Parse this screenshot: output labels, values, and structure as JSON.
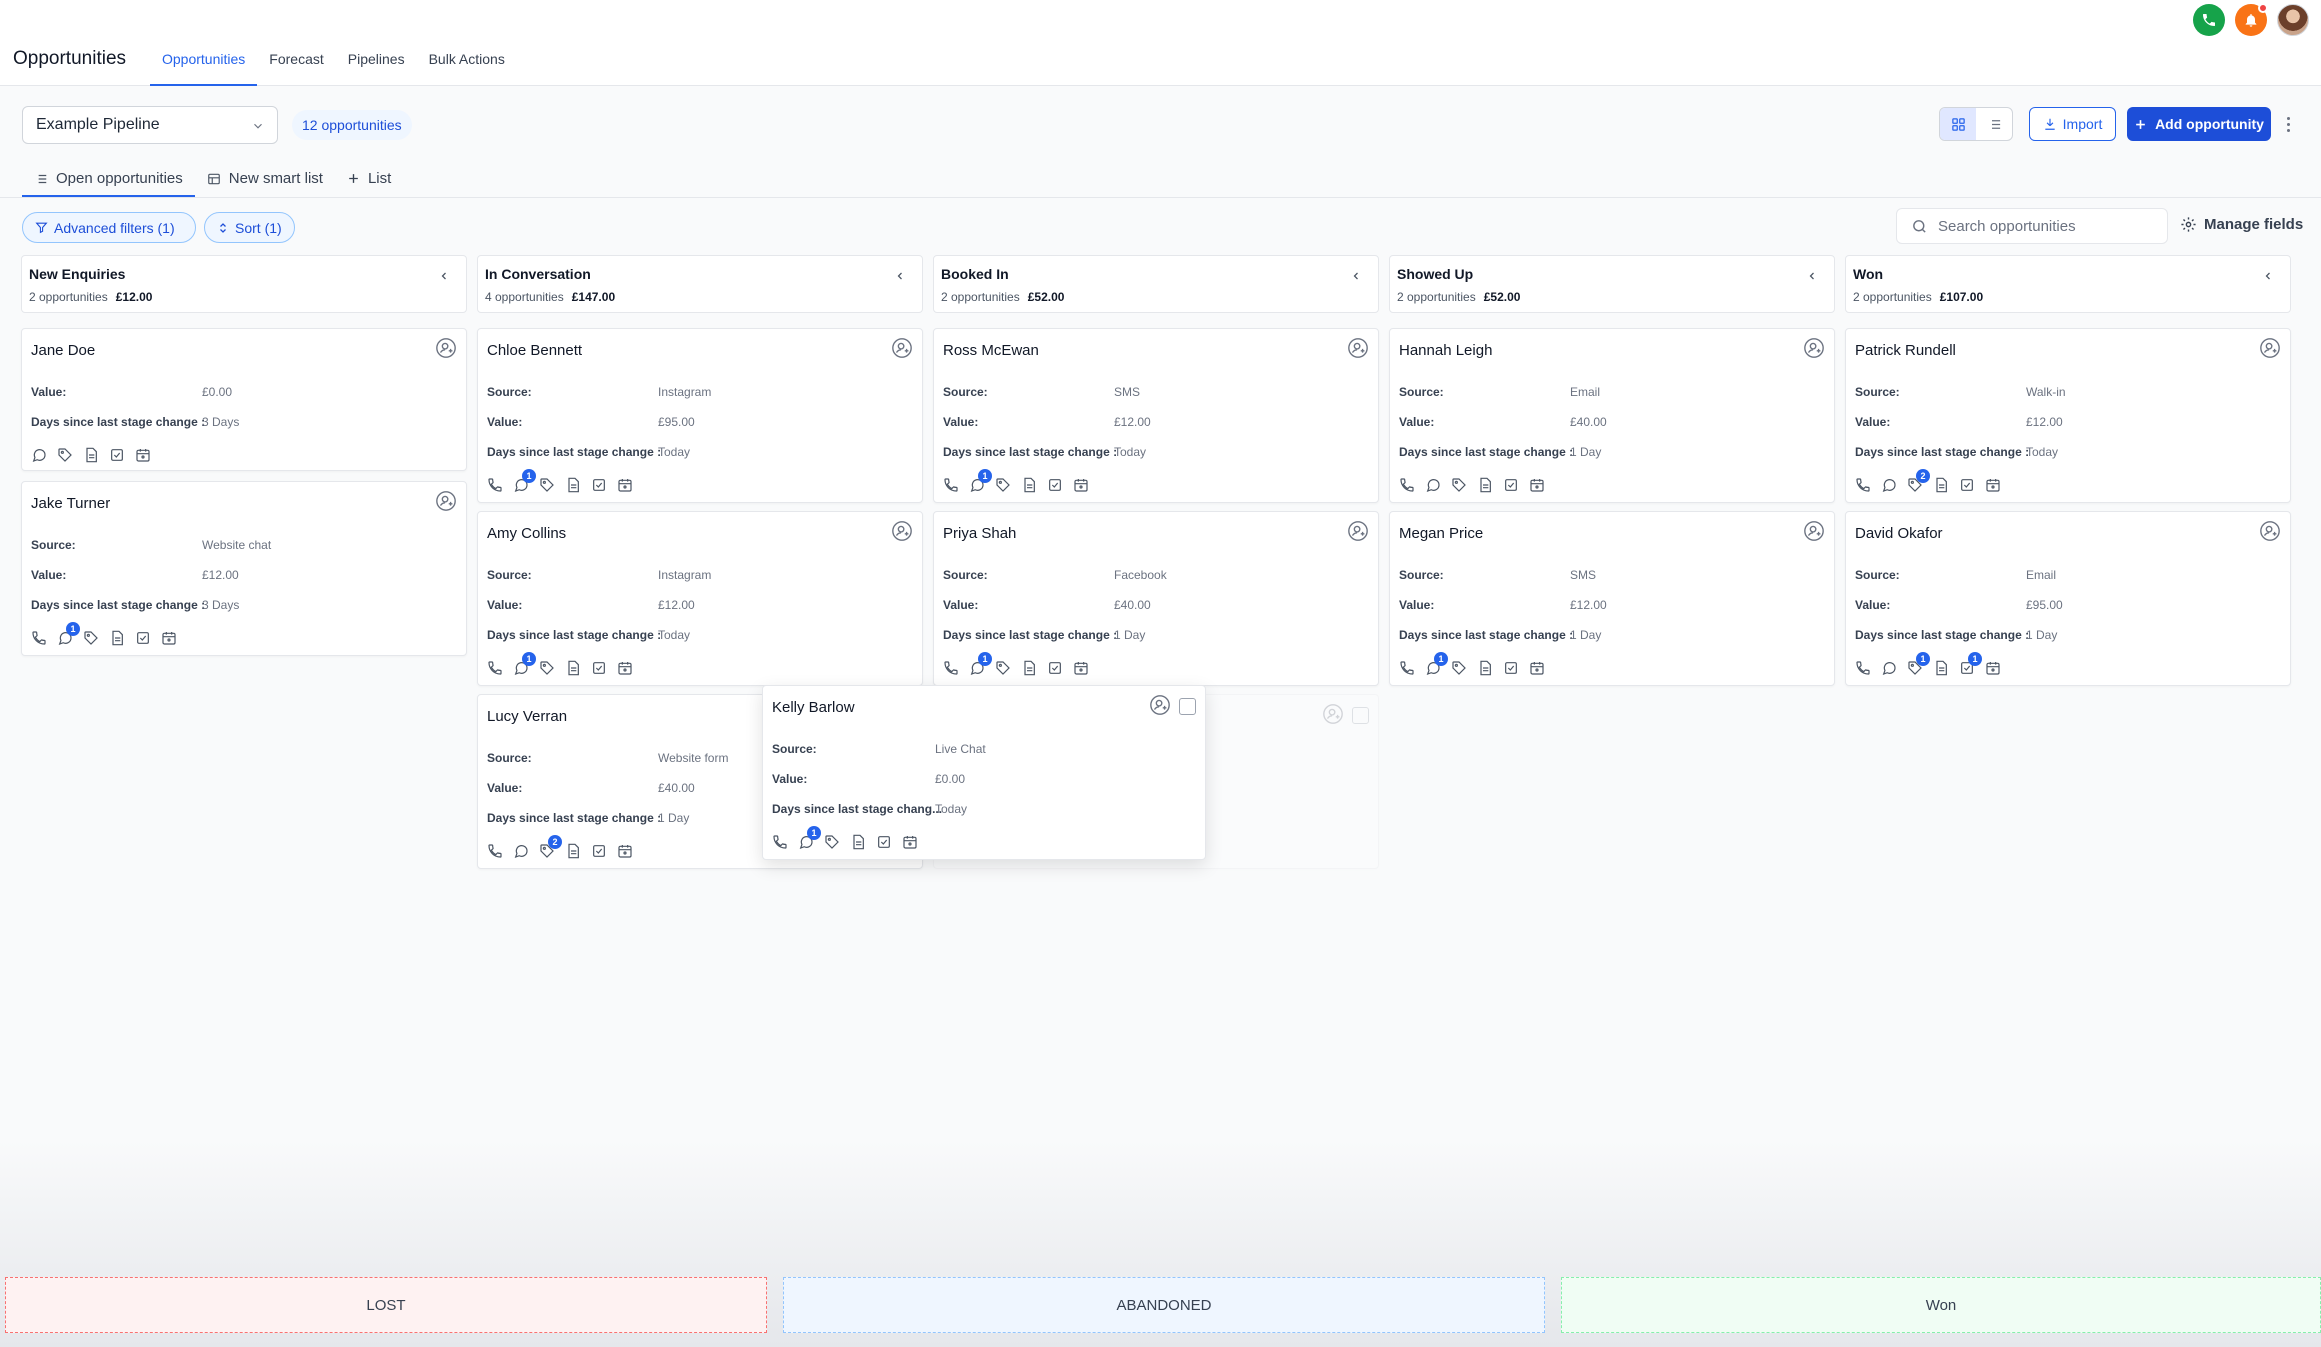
{
  "header": {
    "title": "Opportunities",
    "tabs": [
      "Opportunities",
      "Forecast",
      "Pipelines",
      "Bulk Actions"
    ]
  },
  "toolbar": {
    "pipeline": "Example Pipeline",
    "count_badge": "12 opportunities",
    "import_label": "Import",
    "add_label": "Add opportunity"
  },
  "subtabs": [
    "Open opportunities",
    "New smart list",
    "List"
  ],
  "filters": {
    "advanced": "Advanced filters (1)",
    "sort": "Sort (1)",
    "search_placeholder": "Search opportunities",
    "manage_fields": "Manage fields"
  },
  "labels": {
    "source": "Source:",
    "value": "Value:",
    "days": "Days since last stage change :",
    "days_truncated": "Days since last stage chang..."
  },
  "columns": [
    {
      "name": "New Enquiries",
      "count": "2 opportunities",
      "total": "£12.00",
      "cards": [
        {
          "name": "Jane Doe",
          "value": "£0.00",
          "days": "3 Days"
        },
        {
          "name": "Jake Turner",
          "source": "Website chat",
          "value": "£12.00",
          "days": "3 Days"
        }
      ]
    },
    {
      "name": "In Conversation",
      "count": "4 opportunities",
      "total": "£147.00",
      "cards": [
        {
          "name": "Chloe Bennett",
          "source": "Instagram",
          "value": "£95.00",
          "days": "Today"
        },
        {
          "name": "Amy Collins",
          "source": "Instagram",
          "value": "£12.00",
          "days": "Today"
        },
        {
          "name": "Lucy Verran",
          "source": "Website form",
          "value": "£40.00",
          "days": "1 Day"
        }
      ]
    },
    {
      "name": "Booked In",
      "count": "2 opportunities",
      "total": "£52.00",
      "cards": [
        {
          "name": "Ross McEwan",
          "source": "SMS",
          "value": "£12.00",
          "days": "Today"
        },
        {
          "name": "Priya Shah",
          "source": "Facebook",
          "value": "£40.00",
          "days": "1 Day"
        }
      ]
    },
    {
      "name": "Showed Up",
      "count": "2 opportunities",
      "total": "£52.00",
      "cards": [
        {
          "name": "Hannah Leigh",
          "source": "Email",
          "value": "£40.00",
          "days": "1 Day"
        },
        {
          "name": "Megan Price",
          "source": "SMS",
          "value": "£12.00",
          "days": "1 Day"
        }
      ]
    },
    {
      "name": "Won",
      "count": "2 opportunities",
      "total": "£107.00",
      "cards": [
        {
          "name": "Patrick Rundell",
          "source": "Walk-in",
          "value": "£12.00",
          "days": "Today"
        },
        {
          "name": "David Okafor",
          "source": "Email",
          "value": "£95.00",
          "days": "1 Day"
        }
      ]
    }
  ],
  "dragging": {
    "name": "Kelly Barlow",
    "source": "Live Chat",
    "value": "£0.00",
    "days": "Today"
  },
  "badges": {
    "one": "1",
    "two": "2"
  },
  "dropzones": [
    "LOST",
    "ABANDONED",
    "Won"
  ],
  "colors": {
    "accent": "#2563eb",
    "primary_button": "#1d4ed8",
    "phone": "#16a34a",
    "notification": "#f97316"
  }
}
